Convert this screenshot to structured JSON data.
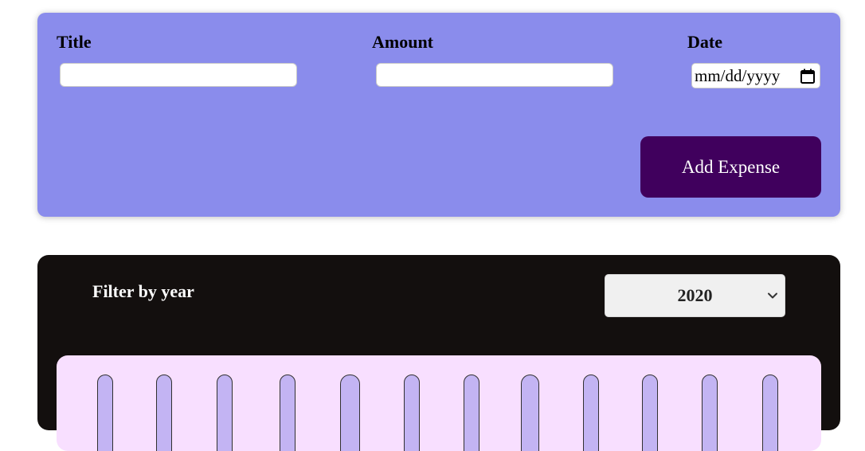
{
  "form": {
    "title_label": "Title",
    "amount_label": "Amount",
    "date_label": "Date",
    "title_value": "",
    "amount_value": "",
    "date_placeholder": "mm/dd/yyyy",
    "add_button_label": "Add Expense",
    "background_color": "#8a8cec",
    "button_color": "#40005d"
  },
  "expenses": {
    "filter_label": "Filter by year",
    "selected_year": "2020",
    "background_color": "#130f0e"
  },
  "chart_data": {
    "type": "bar",
    "bars": 12,
    "track_color": "#c3b4f3",
    "panel_color": "#f8dfff"
  }
}
